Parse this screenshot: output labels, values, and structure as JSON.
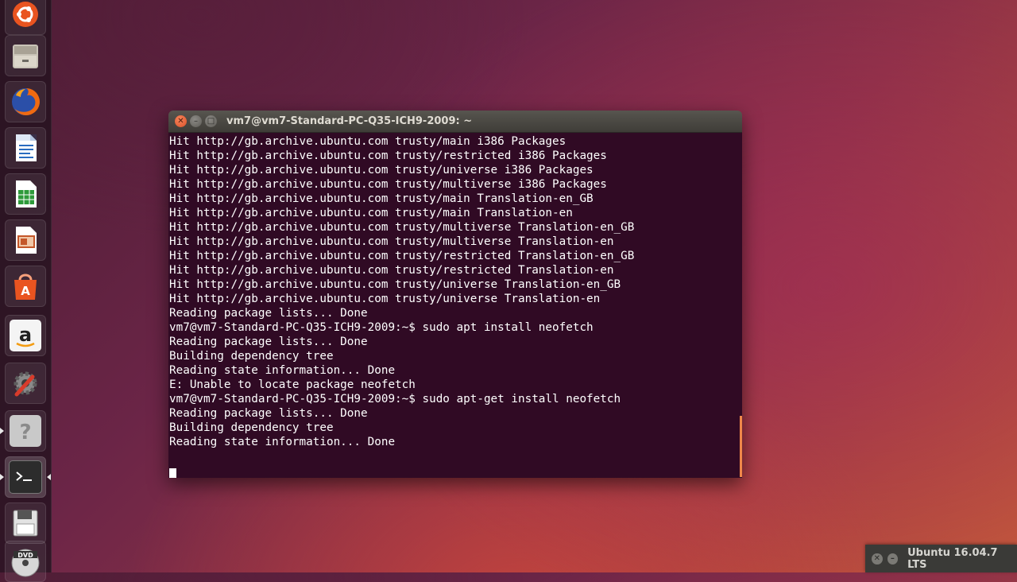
{
  "launcher": {
    "items": [
      {
        "name": "dash-icon",
        "color": "#e95420"
      },
      {
        "name": "files-icon",
        "color": "#b7b0a3"
      },
      {
        "name": "firefox-icon",
        "color": "#e66000"
      },
      {
        "name": "writer-icon",
        "color": "#2a6cc0"
      },
      {
        "name": "calc-icon",
        "color": "#2e9a3a"
      },
      {
        "name": "impress-icon",
        "color": "#c4572a"
      },
      {
        "name": "software-center-icon",
        "color": "#e95420"
      },
      {
        "name": "amazon-icon",
        "color": "#ffffff"
      },
      {
        "name": "system-settings-icon",
        "color": "#8a8a8a"
      },
      {
        "name": "help-icon",
        "color": "#9a9a9a"
      },
      {
        "name": "terminal-icon",
        "color": "#2c2c2c"
      },
      {
        "name": "save-disk-icon",
        "color": "#dcdcdc"
      },
      {
        "name": "dvd-icon",
        "color": "#cfcfcf"
      }
    ]
  },
  "terminal": {
    "title": "vm7@vm7-Standard-PC-Q35-ICH9-2009: ~",
    "lines": [
      "Hit http://gb.archive.ubuntu.com trusty/main i386 Packages",
      "Hit http://gb.archive.ubuntu.com trusty/restricted i386 Packages",
      "Hit http://gb.archive.ubuntu.com trusty/universe i386 Packages",
      "Hit http://gb.archive.ubuntu.com trusty/multiverse i386 Packages",
      "Hit http://gb.archive.ubuntu.com trusty/main Translation-en_GB",
      "Hit http://gb.archive.ubuntu.com trusty/main Translation-en",
      "Hit http://gb.archive.ubuntu.com trusty/multiverse Translation-en_GB",
      "Hit http://gb.archive.ubuntu.com trusty/multiverse Translation-en",
      "Hit http://gb.archive.ubuntu.com trusty/restricted Translation-en_GB",
      "Hit http://gb.archive.ubuntu.com trusty/restricted Translation-en",
      "Hit http://gb.archive.ubuntu.com trusty/universe Translation-en_GB",
      "Hit http://gb.archive.ubuntu.com trusty/universe Translation-en",
      "Reading package lists... Done",
      "vm7@vm7-Standard-PC-Q35-ICH9-2009:~$ sudo apt install neofetch",
      "Reading package lists... Done",
      "Building dependency tree",
      "Reading state information... Done",
      "E: Unable to locate package neofetch",
      "vm7@vm7-Standard-PC-Q35-ICH9-2009:~$ sudo apt-get install neofetch",
      "Reading package lists... Done",
      "Building dependency tree",
      "Reading state information... Done",
      "",
      ""
    ]
  },
  "version_tag": {
    "label": "Ubuntu 16.04.7 LTS"
  }
}
